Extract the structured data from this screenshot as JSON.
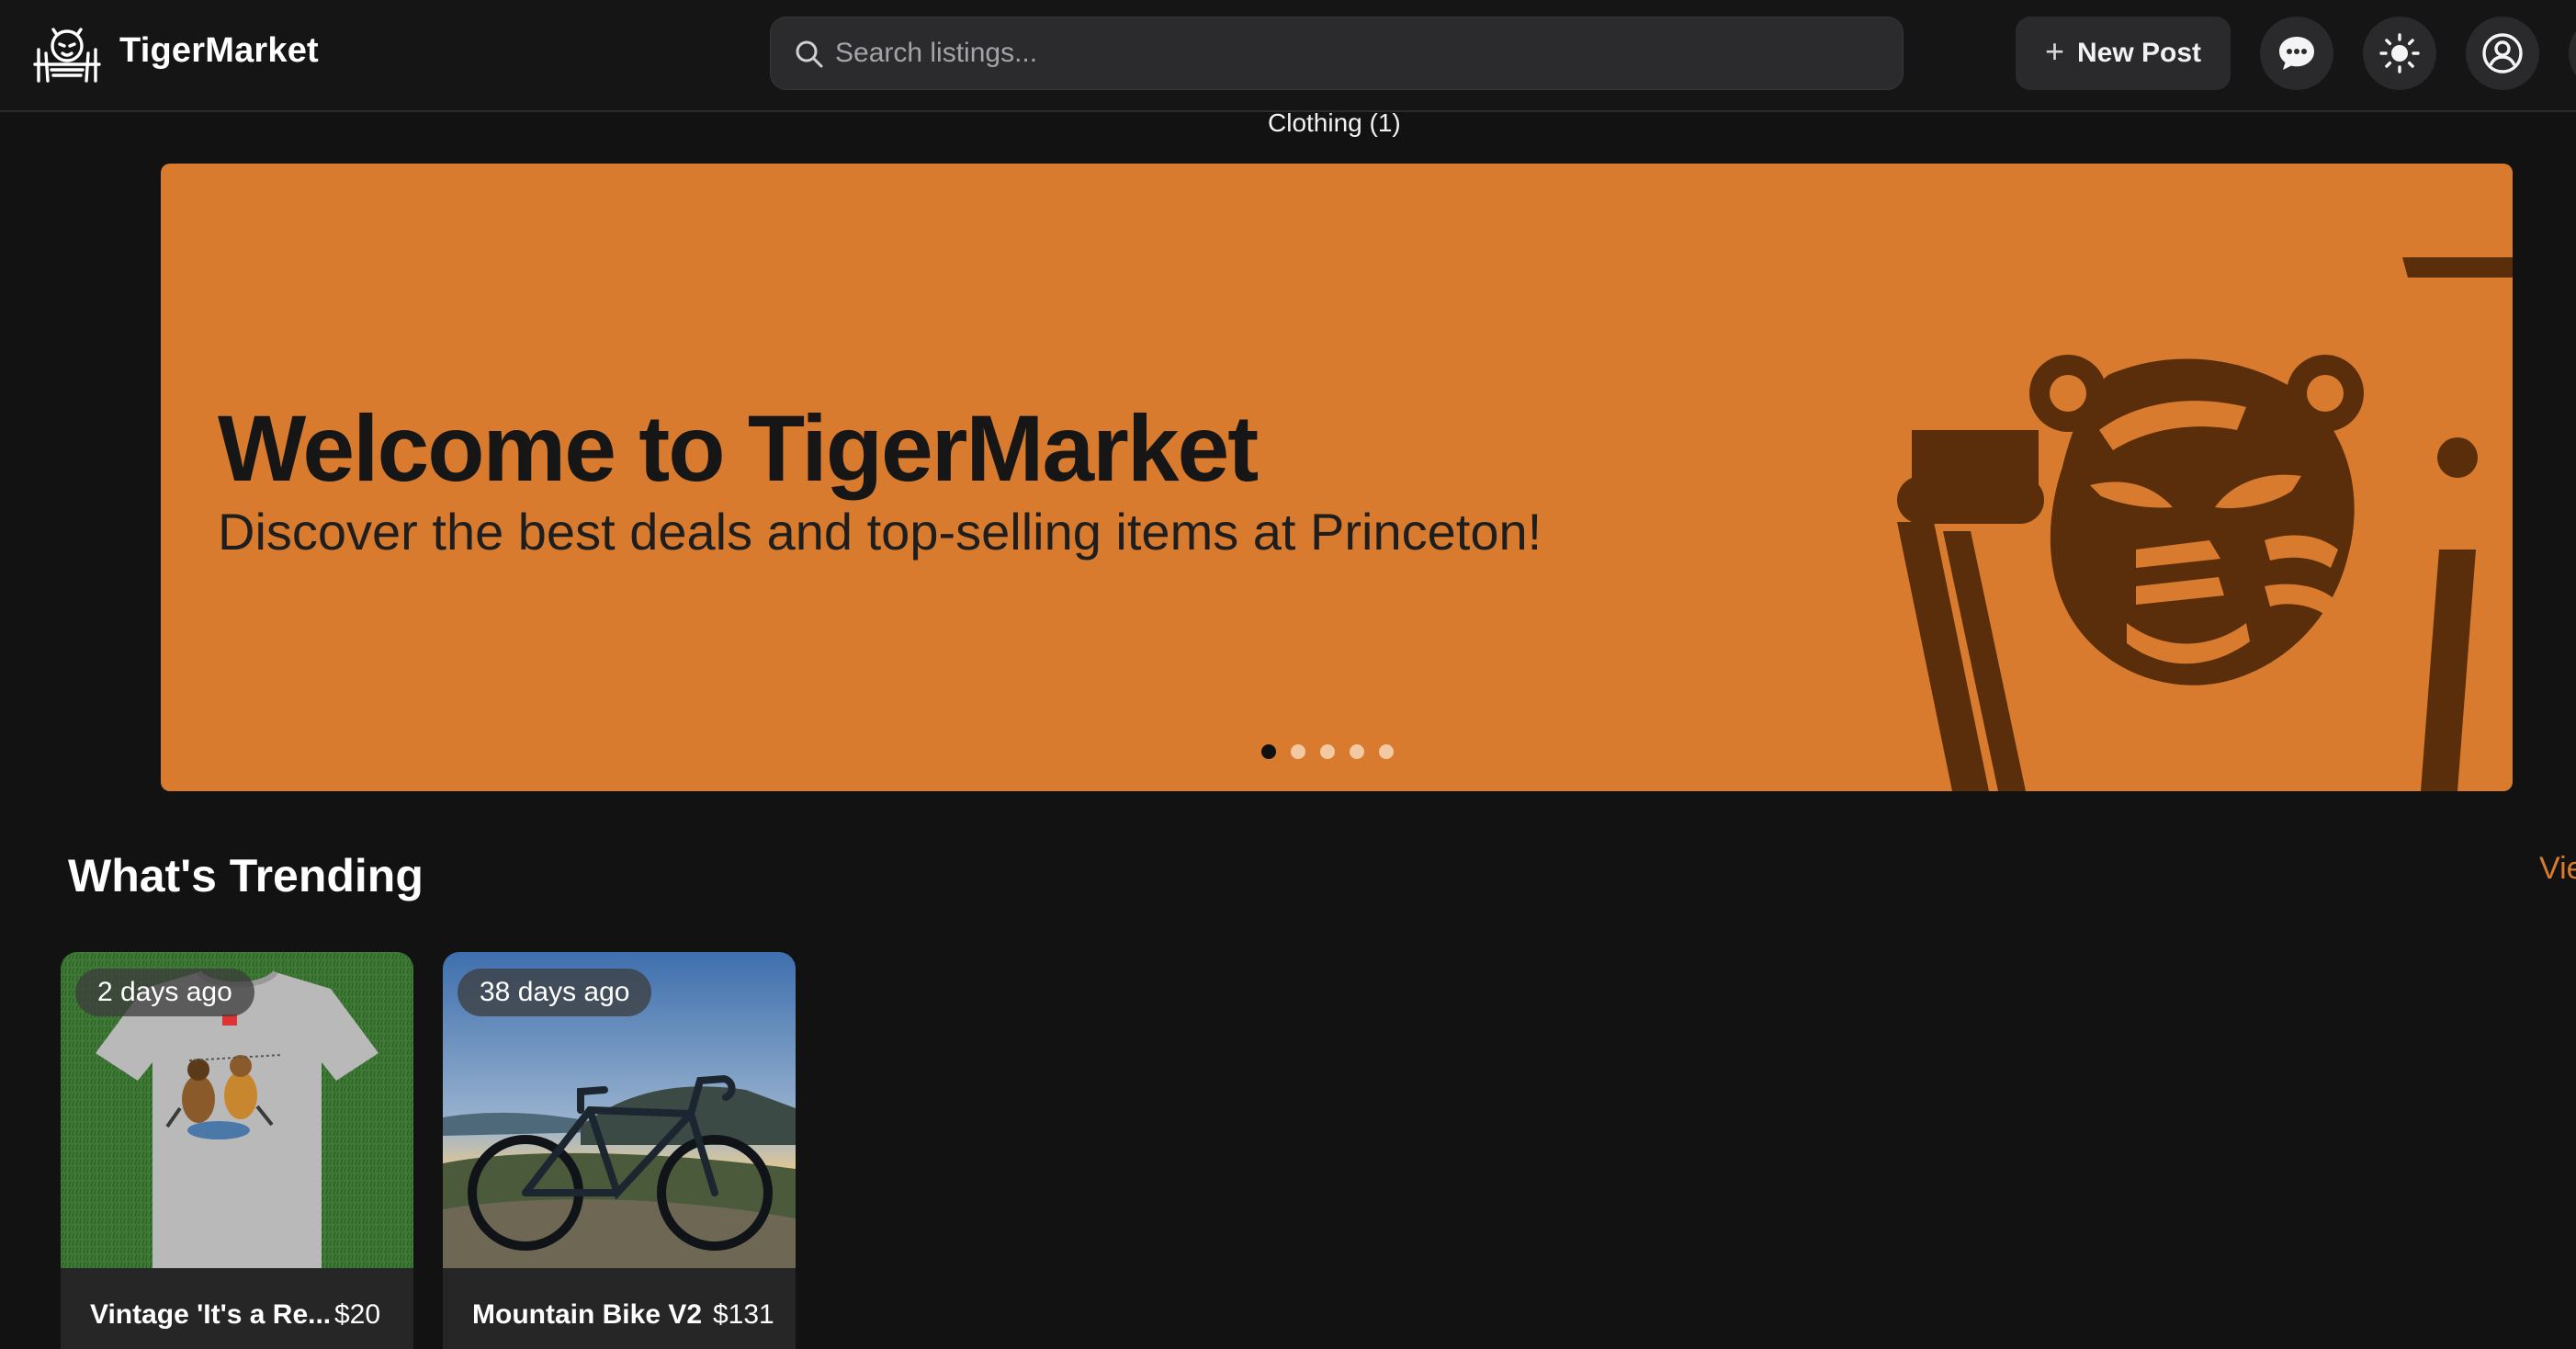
{
  "app": {
    "name": "TigerMarket"
  },
  "header": {
    "search_placeholder": "Search listings...",
    "new_post_label": "New Post",
    "icons": [
      "messages-icon",
      "theme-toggle-icon",
      "account-icon"
    ]
  },
  "category_filter": {
    "label": "Clothing (1)"
  },
  "hero": {
    "title": "Welcome to TigerMarket",
    "subtitle": "Discover the best deals and top-selling items at Princeton!",
    "slide_count": 5,
    "active_slide": 1,
    "background_color": "#d97b2e"
  },
  "trending": {
    "title": "What's Trending",
    "view_all_label": "Vie",
    "items": [
      {
        "age": "2 days ago",
        "name": "Vintage 'It's a Re...",
        "price": "$20"
      },
      {
        "age": "38 days ago",
        "name": "Mountain Bike V2",
        "price": "$131"
      }
    ]
  },
  "colors": {
    "accent": "#d97b2e",
    "background": "#121212",
    "card": "#262626"
  }
}
